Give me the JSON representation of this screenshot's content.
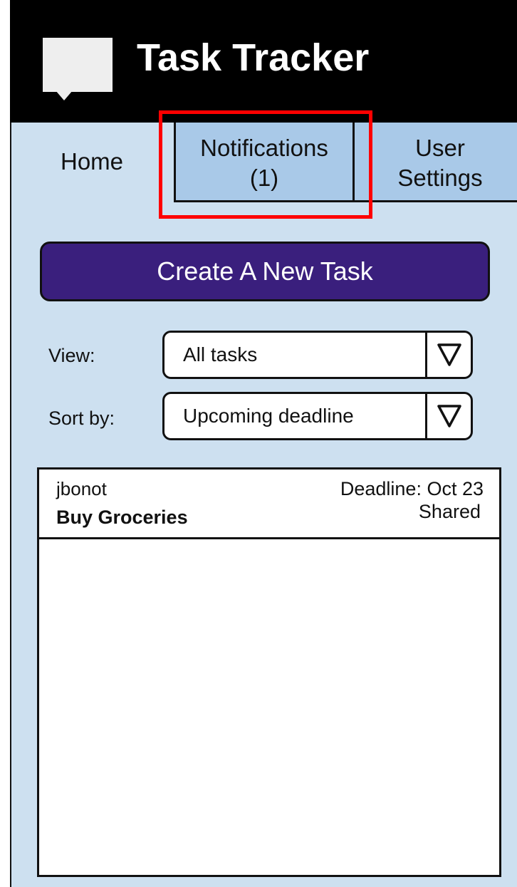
{
  "app": {
    "title": "Task Tracker",
    "logo_icon": "chat-bubble-icon"
  },
  "tabs": [
    {
      "line1": "Home",
      "line2": ""
    },
    {
      "line1": "Notifications",
      "line2": "(1)"
    },
    {
      "line1": "User",
      "line2": "Settings"
    }
  ],
  "actions": {
    "create_label": "Create A New Task"
  },
  "filters": {
    "view_label": "View:",
    "view_value": "All tasks",
    "sort_label": "Sort by:",
    "sort_value": "Upcoming deadline"
  },
  "tasks": [
    {
      "owner": "jbonot",
      "title": "Buy Groceries",
      "deadline": "Deadline: Oct 23",
      "status": "Shared"
    }
  ],
  "colors": {
    "header": "#000000",
    "panel": "#cde0f0",
    "tab_inactive": "#a9c9e8",
    "button": "#3a1f7d",
    "highlight": "#ff0000"
  }
}
